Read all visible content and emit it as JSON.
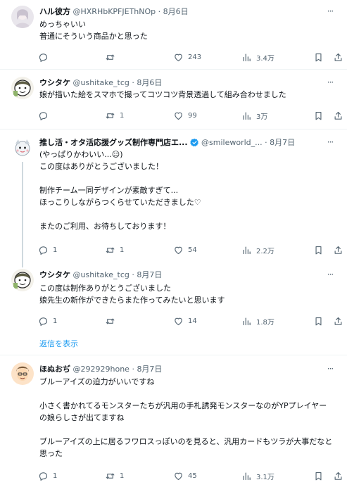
{
  "posts": [
    {
      "name": "ハル彼方",
      "handle": "@HXRHbKPFJEThNOp",
      "dot": "·",
      "date": "8月6日",
      "text": "めっちゃいい\n普通にそういう商品かと思った",
      "replies": "",
      "reposts": "",
      "likes": "243",
      "views": "3.4万"
    },
    {
      "name": "ウシタケ",
      "handle": "@ushitake_tcg",
      "dot": "·",
      "date": "8月6日",
      "text": "娘が描いた絵をスマホで撮ってコツコツ背景透過して組み合わせました",
      "replies": "",
      "reposts": "1",
      "likes": "99",
      "views": "3万"
    },
    {
      "name": "推し活・オタ活応援グッズ制作専門店エ...",
      "handle": "@smileworld_...",
      "dot": "·",
      "date": "8月7日",
      "text": "(やっぱりかわいい...☺)\nこの度はありがとうございました！\n\n制作チーム一同デザインが素敵すぎて...\nほっこりしながらつくらせていただきました♡\n\nまたのご利用、お待ちしております！",
      "replies": "1",
      "reposts": "1",
      "likes": "54",
      "views": "2.2万"
    },
    {
      "name": "ウシタケ",
      "handle": "@ushitake_tcg",
      "dot": "·",
      "date": "8月7日",
      "text": "この度は制作ありがとうございました\n娘先生の新作ができたらまた作ってみたいと思います",
      "replies": "1",
      "reposts": "",
      "likes": "14",
      "views": "1.8万"
    },
    {
      "name": "ほぬおぢ",
      "handle": "@292929hone",
      "dot": "·",
      "date": "8月7日",
      "text": "ブルーアイズの迫力がいいですね\n\n小さく書かれてるモンスターたちが汎用の手札誘発モンスターなのがYPプレイヤーの娘らしさが出てますね\n\nブルーアイズの上に居るフワロスっぽいのを見ると、汎用カードもツラが大事だなと思った",
      "replies": "1",
      "reposts": "1",
      "likes": "45",
      "views": "3.1万"
    }
  ],
  "show_replies": "返信を表示",
  "colors": {
    "text": "#0f1419",
    "secondary": "#536471",
    "link": "#1d9bf0",
    "divider": "#eff3f4",
    "thread": "#cfd9de"
  },
  "icons": {
    "reply": "reply-icon",
    "repost": "repost-icon",
    "like": "heart-icon",
    "views": "views-icon",
    "bookmark": "bookmark-icon",
    "share": "share-icon",
    "more": "more-icon",
    "verified": "verified-badge-icon"
  }
}
